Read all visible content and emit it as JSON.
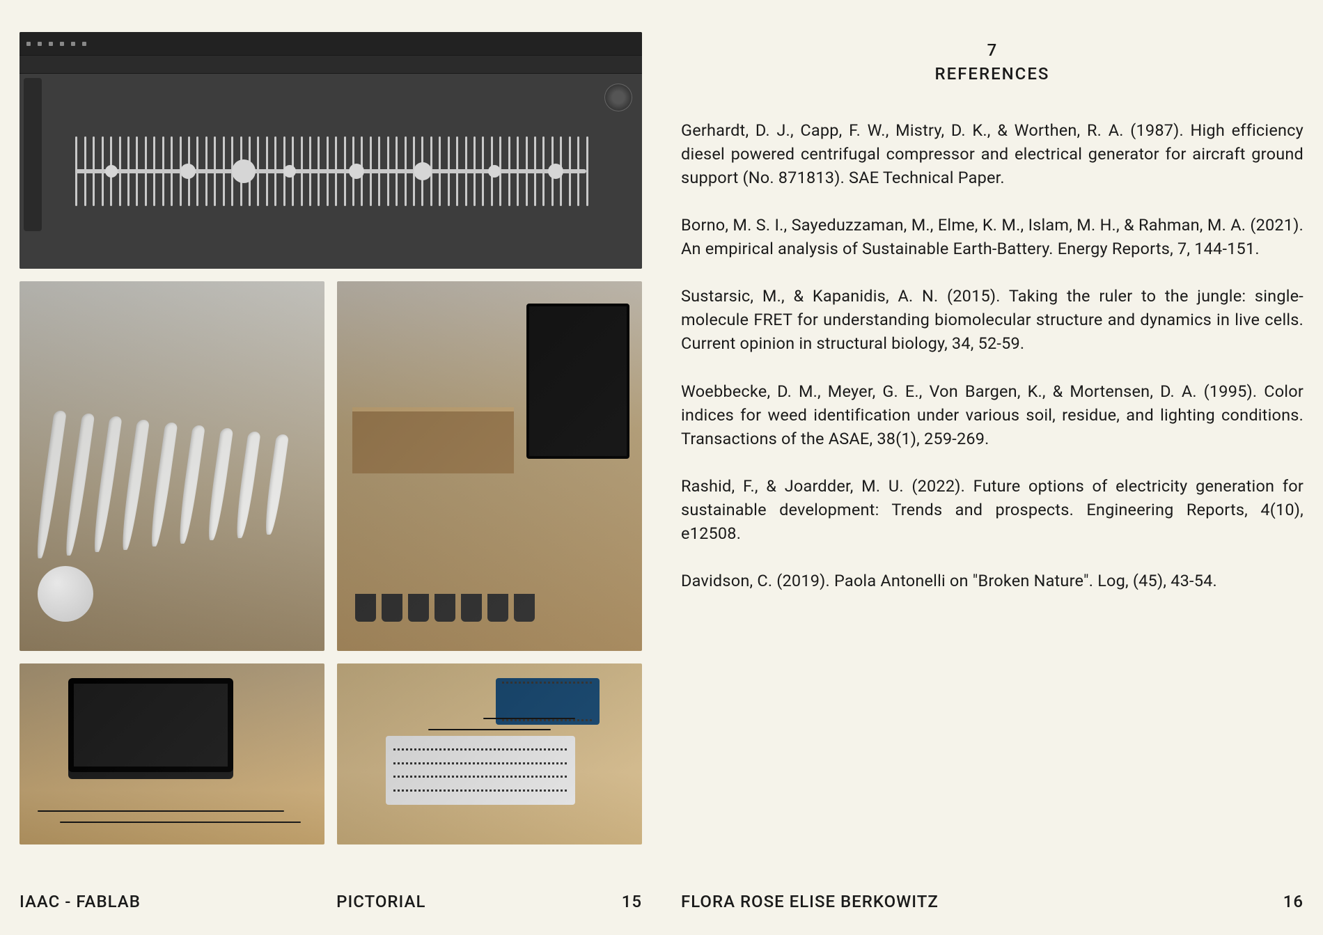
{
  "left_page": {
    "footer": {
      "institution": "IAAC - FABLAB",
      "center": "PICTORIAL",
      "page_number": "15"
    },
    "images": {
      "top": {
        "caption": "Blender 3D viewport showing procedural spine/rib geometry"
      },
      "mid_l": {
        "caption": "White 3D-printed ribbed structure on plywood surface"
      },
      "mid_r": {
        "caption": "Workbench with printed parts, soil cups, wires and monitor"
      },
      "bot_l": {
        "caption": "Laptop running Blender on plywood desk with soil cups and wiring"
      },
      "bot_r": {
        "caption": "Arduino and breadboard with jumper wires on plywood"
      }
    }
  },
  "right_page": {
    "section_number": "7",
    "section_title": "REFERENCES",
    "references": [
      "Gerhardt, D. J., Capp, F. W., Mistry, D. K., & Worthen, R. A. (1987). High efficiency diesel powered centrifugal compressor and electrical generator for aircraft ground support (No. 871813). SAE Technical Paper.",
      "Borno, M. S. I., Sayeduzzaman, M., Elme, K. M., Islam, M. H., & Rahman, M. A. (2021). An empirical analysis of Sustainable Earth-Battery. Energy Reports, 7, 144-151.",
      "Sustarsic, M., & Kapanidis, A. N. (2015). Taking the ruler to the jungle: single-molecule FRET for understanding biomolecular structure and dynamics in live cells. Current opinion in structural biology, 34, 52-59.",
      "Woebbecke, D. M., Meyer, G. E., Von Bargen, K., & Mortensen, D. A. (1995). Color indices for weed identification under various soil, residue, and lighting conditions. Transactions of the ASAE, 38(1), 259-269.",
      "Rashid, F., & Joardder, M. U. (2022). Future options of electricity generation for sustainable development: Trends and prospects. Engineering Reports, 4(10), e12508.",
      "Davidson, C. (2019). Paola Antonelli on \"Broken Nature\". Log, (45), 43-54."
    ],
    "footer": {
      "author": "FLORA ROSE ELISE BERKOWITZ",
      "page_number": "16"
    }
  }
}
